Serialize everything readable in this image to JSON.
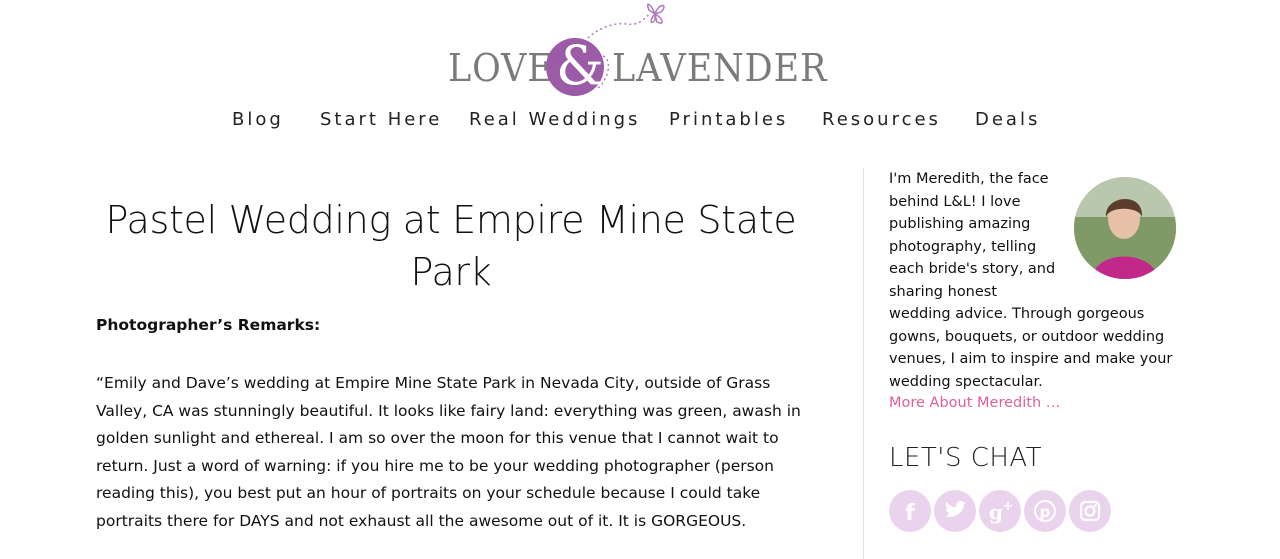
{
  "logo": {
    "word_left": "LOVE",
    "ampersand": "&",
    "word_right": "LAVENDER"
  },
  "nav": {
    "items": [
      {
        "label": "Blog"
      },
      {
        "label": "Start Here"
      },
      {
        "label": "Real Weddings"
      },
      {
        "label": "Printables"
      },
      {
        "label": "Resources"
      },
      {
        "label": "Deals"
      }
    ]
  },
  "post": {
    "title": "Pastel Wedding at Empire Mine State Park",
    "remarks_label": "Photographer’s Remarks:",
    "body": "“Emily and Dave’s wedding at Empire Mine State Park in Nevada City, outside of Grass Valley, CA was stunningly beautiful. It looks like fairy land: everything was green, awash in golden sunlight and ethereal. I am so over the moon for this venue that I cannot wait to return. Just a word of warning: if you hire me to be your wedding photographer (person reading this), you best put an hour of portraits on your schedule because I could take portraits there for DAYS and not exhaust all the awesome out of it. It is GORGEOUS."
  },
  "sidebar": {
    "bio_lines": [
      "I'm Meredith, the face",
      "behind L&L! I love",
      "publishing amazing",
      "photography, telling",
      "each bride's story, and",
      "sharing honest",
      "wedding advice. Through gorgeous",
      "gowns, bouquets, or outdoor wedding",
      "venues, I aim to inspire and make your",
      "wedding spectacular."
    ],
    "more_link": "More About Meredith …",
    "chat_heading": "LET'S CHAT",
    "social_icons": [
      "facebook-icon",
      "twitter-icon",
      "google-plus-icon",
      "pinterest-icon",
      "instagram-icon"
    ]
  },
  "colors": {
    "accent_purple": "#9c5ba6",
    "link_pink": "#e0609b",
    "social_bg": "#ead3ec"
  }
}
